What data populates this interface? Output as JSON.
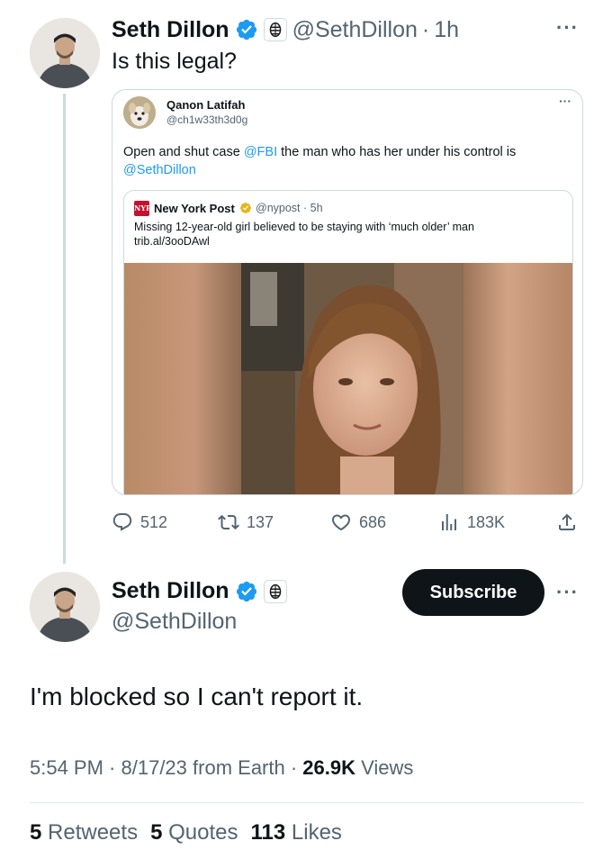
{
  "tweet": {
    "author_name": "Seth Dillon",
    "handle": "@SethDillon",
    "time": "1h",
    "separator": "·",
    "text": "Is this legal?",
    "more": "···"
  },
  "quoted": {
    "author_name": "Qanon Latifah",
    "handle": "@ch1w33th3d0g",
    "more": "···",
    "text_before": "Open and shut case ",
    "mention_fbi": "@FBI",
    "text_middle": " the man who has her under his control is",
    "mention_seth": "@SethDillon"
  },
  "nested": {
    "logo_text": "NYP",
    "author_name": "New York Post",
    "handle": "@nypost",
    "time": "5h",
    "headline": "Missing 12-year-old girl believed to be staying with ‘much older’ man",
    "link": "trib.al/3ooDAwl"
  },
  "actions": {
    "replies": "512",
    "retweets": "137",
    "likes": "686",
    "views": "183K"
  },
  "reply": {
    "author_name": "Seth Dillon",
    "handle": "@SethDillon",
    "subscribe_label": "Subscribe",
    "more": "···",
    "text": "I'm blocked so I can't report it.",
    "time": "5:54 PM",
    "date": "8/17/23",
    "source": "from Earth",
    "views_count": "26.9K",
    "views_label": "Views"
  },
  "stats": {
    "retweets_count": "5",
    "retweets_label": "Retweets",
    "quotes_count": "5",
    "quotes_label": "Quotes",
    "likes_count": "113",
    "likes_label": "Likes"
  },
  "colors": {
    "verified_blue": "#1d9bf0",
    "gold_badge": "#e2b719",
    "nyp_red": "#c8102e",
    "text_secondary": "#536471"
  },
  "icons": {
    "verified": "verified-badge-icon",
    "affiliation": "babylon-bee-affiliation-icon",
    "reply": "reply-icon",
    "retweet": "retweet-icon",
    "like": "heart-icon",
    "views": "views-chart-icon",
    "share": "share-icon"
  }
}
